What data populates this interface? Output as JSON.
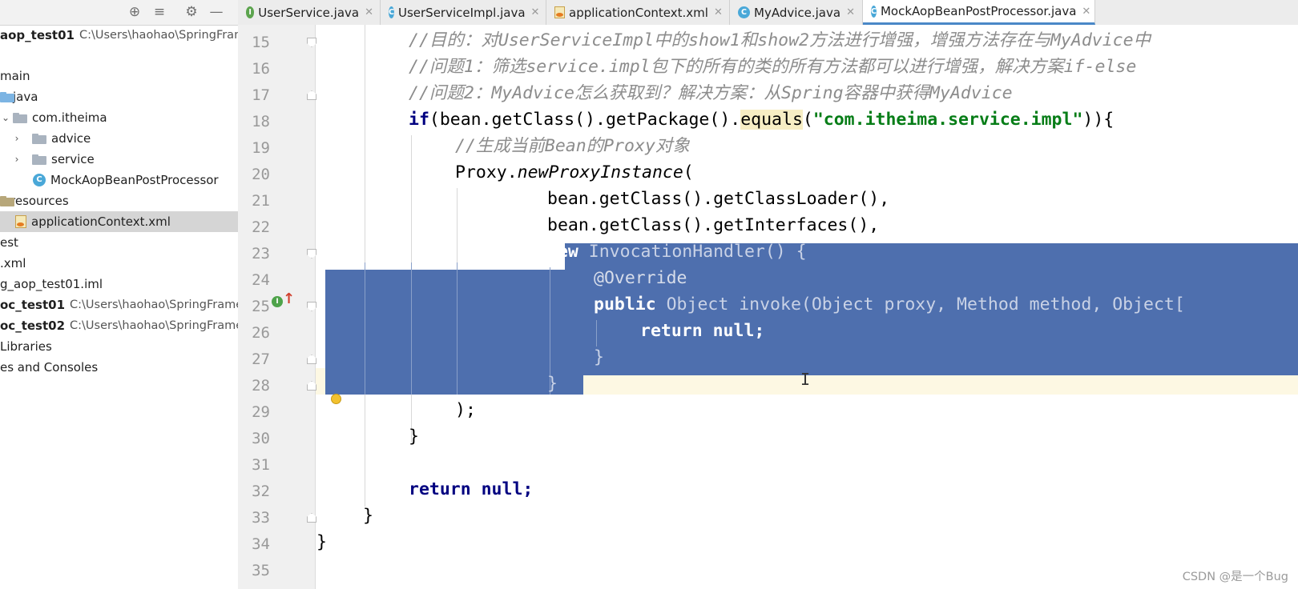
{
  "project_panel": {
    "toolbar_icons": [
      "crosshair-icon",
      "collapse-icon",
      "gear-icon",
      "minimize-icon"
    ],
    "tree": [
      {
        "label": "aop_test01",
        "path": "C:\\Users\\haohao\\SpringFrame",
        "kind": "module"
      },
      {
        "label": "main",
        "kind": "folder"
      },
      {
        "label": "java",
        "kind": "source-folder"
      },
      {
        "label": "com.itheima",
        "kind": "package"
      },
      {
        "label": "advice",
        "kind": "package"
      },
      {
        "label": "service",
        "kind": "package"
      },
      {
        "label": "MockAopBeanPostProcessor",
        "kind": "class"
      },
      {
        "label": "resources",
        "kind": "resource-folder"
      },
      {
        "label": "applicationContext.xml",
        "kind": "xml",
        "selected": true
      },
      {
        "label": "est",
        "kind": "folder"
      },
      {
        "label": ".xml",
        "kind": "file"
      },
      {
        "label": "g_aop_test01.iml",
        "kind": "file"
      },
      {
        "label": "oc_test01",
        "path": "C:\\Users\\haohao\\SpringFramew",
        "kind": "module"
      },
      {
        "label": "oc_test02",
        "path": "C:\\Users\\haohao\\SpringFramew",
        "kind": "module"
      },
      {
        "label": "Libraries",
        "kind": "item"
      },
      {
        "label": "es and Consoles",
        "kind": "item"
      }
    ]
  },
  "tabs": [
    {
      "label": "UserService.java",
      "icon": "interface-icon"
    },
    {
      "label": "UserServiceImpl.java",
      "icon": "class-icon"
    },
    {
      "label": "applicationContext.xml",
      "icon": "xml-icon"
    },
    {
      "label": "MyAdvice.java",
      "icon": "class-icon"
    },
    {
      "label": "MockAopBeanPostProcessor.java",
      "icon": "class-icon",
      "active": true
    }
  ],
  "editor": {
    "line_numbers": [
      "15",
      "16",
      "17",
      "18",
      "19",
      "20",
      "21",
      "22",
      "23",
      "24",
      "25",
      "26",
      "27",
      "28",
      "29",
      "30",
      "31",
      "32",
      "33",
      "34",
      "35"
    ],
    "lines": {
      "l15": "//目的：对UserServiceImpl中的show1和show2方法进行增强，增强方法存在与MyAdvice中",
      "l16": "//问题1：筛选service.impl包下的所有的类的所有方法都可以进行增强，解决方案if-else",
      "l17": "//问题2：MyAdvice怎么获取到？解决方案：从Spring容器中获得MyAdvice",
      "l18_kw": "if",
      "l18_a": "(bean.getClass().getPackage().",
      "l18_equals": "equals",
      "l18_b": "(",
      "l18_str": "\"com.itheima.service.impl\"",
      "l18_c": ")){",
      "l19": "//生成当前Bean的Proxy对象",
      "l20_a": "Proxy.",
      "l20_b": "newProxyInstance",
      "l20_c": "(",
      "l21": "bean.getClass().getClassLoader(),",
      "l22": "bean.getClass().getInterfaces(),",
      "l23_kw": "new",
      "l23_rest": " InvocationHandler() {",
      "l24": "@Override",
      "l25_kw": "public",
      "l25_rest": " Object invoke(Object proxy, Method method, Object[",
      "l26_kw": "return",
      "l26_rest": " null;",
      "l27": "}",
      "l28": "}",
      "l29": ");",
      "l30": "}",
      "l32_kw": "return",
      "l32_rest": " null;",
      "l33": "}",
      "l34": "}"
    }
  },
  "watermark": "CSDN @是一个Bug"
}
